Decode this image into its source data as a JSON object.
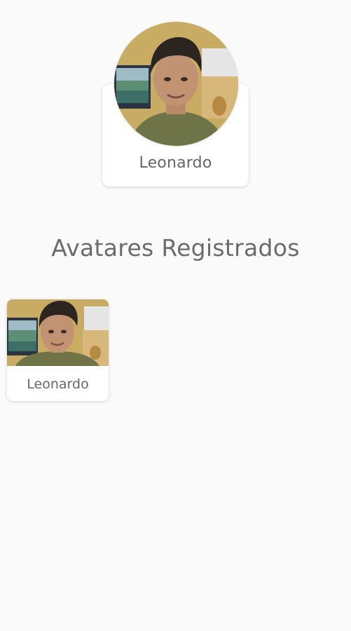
{
  "current_avatar": {
    "name": "Leonardo",
    "photo_icon": "person-photo"
  },
  "registered": {
    "title": "Avatares Registrados",
    "items": [
      {
        "name": "Leonardo",
        "photo_icon": "person-photo"
      }
    ]
  },
  "colors": {
    "background": "#fafafa",
    "card": "#ffffff",
    "text": "#666666"
  }
}
